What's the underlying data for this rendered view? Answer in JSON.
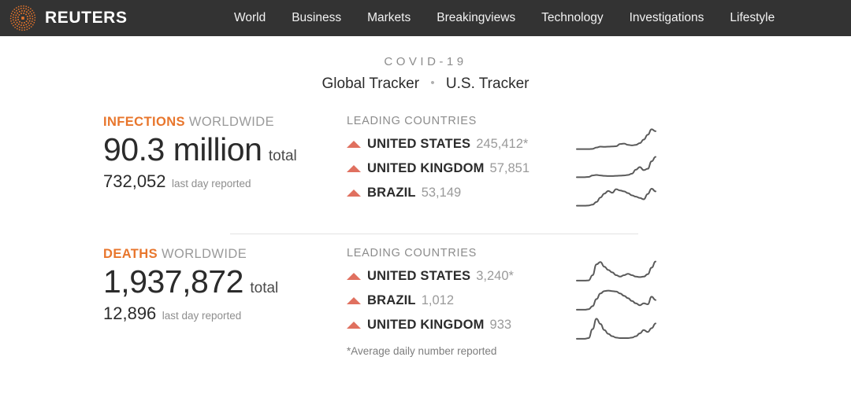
{
  "header": {
    "brand": "REUTERS",
    "logo_icon": "reuters-dots-logo",
    "accent_color": "#e8762c",
    "background": "#333333",
    "nav": [
      {
        "label": "World"
      },
      {
        "label": "Business"
      },
      {
        "label": "Markets"
      },
      {
        "label": "Breakingviews"
      },
      {
        "label": "Technology"
      },
      {
        "label": "Investigations"
      },
      {
        "label": "Lifestyle"
      }
    ]
  },
  "tracker": {
    "eyebrow": "COVID-19",
    "tabs": [
      {
        "label": "Global Tracker"
      },
      {
        "label": "U.S. Tracker"
      }
    ],
    "tab_separator": "•"
  },
  "sections": [
    {
      "id": "infections",
      "keyword": "INFECTIONS",
      "scope": "WORLDWIDE",
      "total_value": "90.3 million",
      "total_suffix": "total",
      "daily_value": "732,052",
      "daily_suffix": "last day reported",
      "countries_title": "LEADING COUNTRIES",
      "countries": [
        {
          "name": "UNITED STATES",
          "value": "245,412*",
          "trend_icon": "triangle-up-icon"
        },
        {
          "name": "UNITED KINGDOM",
          "value": "57,851",
          "trend_icon": "triangle-up-icon"
        },
        {
          "name": "BRAZIL",
          "value": "53,149",
          "trend_icon": "triangle-up-icon"
        }
      ],
      "footnote": ""
    },
    {
      "id": "deaths",
      "keyword": "DEATHS",
      "scope": "WORLDWIDE",
      "total_value": "1,937,872",
      "total_suffix": "total",
      "daily_value": "12,896",
      "daily_suffix": "last day reported",
      "countries_title": "LEADING COUNTRIES",
      "countries": [
        {
          "name": "UNITED STATES",
          "value": "3,240*",
          "trend_icon": "triangle-up-icon"
        },
        {
          "name": "BRAZIL",
          "value": "1,012",
          "trend_icon": "triangle-up-icon"
        },
        {
          "name": "UNITED KINGDOM",
          "value": "933",
          "trend_icon": "triangle-up-icon"
        }
      ],
      "footnote": "*Average daily number reported"
    }
  ],
  "chart_data": [
    {
      "type": "line",
      "title": "United States infections trend",
      "series_name": "UNITED STATES",
      "xlabel": "",
      "ylabel": "",
      "grid": false,
      "legend": "none",
      "ylim": [
        0,
        1
      ],
      "x": [
        0,
        5,
        10,
        15,
        20,
        25,
        30,
        35,
        40,
        45,
        50,
        55,
        60,
        65,
        70,
        75,
        80,
        85,
        90,
        95,
        100
      ],
      "values": [
        0.05,
        0.05,
        0.05,
        0.05,
        0.06,
        0.12,
        0.16,
        0.15,
        0.16,
        0.17,
        0.18,
        0.28,
        0.3,
        0.24,
        0.22,
        0.24,
        0.32,
        0.48,
        0.7,
        0.95,
        0.86
      ]
    },
    {
      "type": "line",
      "title": "United Kingdom infections trend",
      "series_name": "UNITED KINGDOM",
      "xlabel": "",
      "ylabel": "",
      "grid": false,
      "legend": "none",
      "ylim": [
        0,
        1
      ],
      "x": [
        0,
        5,
        10,
        15,
        20,
        25,
        30,
        35,
        40,
        45,
        50,
        55,
        60,
        65,
        70,
        75,
        80,
        85,
        90,
        95,
        100
      ],
      "values": [
        0.06,
        0.06,
        0.06,
        0.07,
        0.14,
        0.16,
        0.14,
        0.12,
        0.11,
        0.11,
        0.12,
        0.13,
        0.14,
        0.16,
        0.22,
        0.4,
        0.52,
        0.38,
        0.44,
        0.78,
        0.98
      ]
    },
    {
      "type": "line",
      "title": "Brazil infections trend",
      "series_name": "BRAZIL",
      "xlabel": "",
      "ylabel": "",
      "grid": false,
      "legend": "none",
      "ylim": [
        0,
        1
      ],
      "x": [
        0,
        5,
        10,
        15,
        20,
        25,
        30,
        35,
        40,
        45,
        50,
        55,
        60,
        65,
        70,
        75,
        80,
        85,
        90,
        95,
        100
      ],
      "values": [
        0.05,
        0.05,
        0.05,
        0.06,
        0.1,
        0.22,
        0.42,
        0.6,
        0.72,
        0.64,
        0.8,
        0.74,
        0.7,
        0.62,
        0.52,
        0.46,
        0.4,
        0.34,
        0.58,
        0.82,
        0.7
      ]
    },
    {
      "type": "line",
      "title": "United States deaths trend",
      "series_name": "UNITED STATES",
      "xlabel": "",
      "ylabel": "",
      "grid": false,
      "legend": "none",
      "ylim": [
        0,
        1
      ],
      "x": [
        0,
        5,
        10,
        15,
        20,
        25,
        30,
        35,
        40,
        45,
        50,
        55,
        60,
        65,
        70,
        75,
        80,
        85,
        90,
        95,
        100
      ],
      "values": [
        0.07,
        0.07,
        0.07,
        0.08,
        0.3,
        0.76,
        0.86,
        0.66,
        0.52,
        0.42,
        0.3,
        0.24,
        0.3,
        0.36,
        0.3,
        0.24,
        0.22,
        0.24,
        0.34,
        0.62,
        0.88
      ]
    },
    {
      "type": "line",
      "title": "Brazil deaths trend",
      "series_name": "BRAZIL",
      "xlabel": "",
      "ylabel": "",
      "grid": false,
      "legend": "none",
      "ylim": [
        0,
        1
      ],
      "x": [
        0,
        5,
        10,
        15,
        20,
        25,
        30,
        35,
        40,
        45,
        50,
        55,
        60,
        65,
        70,
        75,
        80,
        85,
        90,
        95,
        100
      ],
      "values": [
        0.07,
        0.07,
        0.07,
        0.09,
        0.22,
        0.52,
        0.76,
        0.86,
        0.88,
        0.86,
        0.84,
        0.76,
        0.66,
        0.56,
        0.44,
        0.34,
        0.26,
        0.34,
        0.3,
        0.62,
        0.48
      ]
    },
    {
      "type": "line",
      "title": "United Kingdom deaths trend",
      "series_name": "UNITED KINGDOM",
      "xlabel": "",
      "ylabel": "",
      "grid": false,
      "legend": "none",
      "ylim": [
        0,
        1
      ],
      "x": [
        0,
        5,
        10,
        15,
        20,
        25,
        30,
        35,
        40,
        45,
        50,
        55,
        60,
        65,
        70,
        75,
        80,
        85,
        90,
        95,
        100
      ],
      "values": [
        0.07,
        0.07,
        0.07,
        0.1,
        0.48,
        0.92,
        0.7,
        0.44,
        0.28,
        0.18,
        0.12,
        0.1,
        0.1,
        0.1,
        0.12,
        0.18,
        0.3,
        0.44,
        0.36,
        0.52,
        0.72
      ]
    }
  ]
}
